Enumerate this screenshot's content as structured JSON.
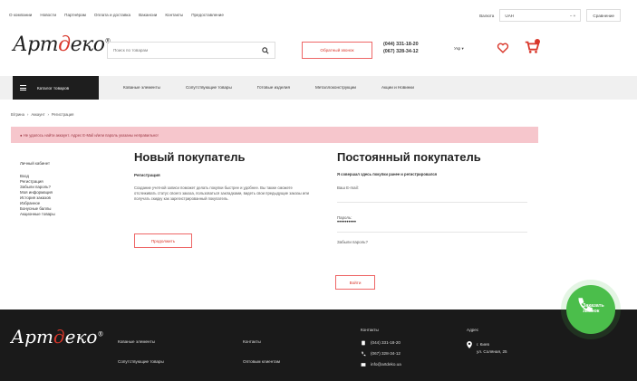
{
  "topbar": {
    "nav": [
      "О компании",
      "Новости",
      "Партнёрам",
      "Оплата и доставка",
      "Вакансии",
      "Контакты",
      "Предоставление"
    ],
    "currency_label": "Валюта",
    "currency_value": "UAH",
    "qty_controls": "−  +",
    "compare_label": "Сравнение"
  },
  "header": {
    "logo_main": "Арт",
    "logo_accent": "д",
    "logo_tail": "еко",
    "logo_mark": "®",
    "search_placeholder": "Поиск по товарам",
    "callback_label": "Обратный звонок",
    "phone1": "(044) 331-18-20",
    "phone2": "(067) 328-34-12",
    "lang": "Укр ▾"
  },
  "navbar": {
    "catalog_label": "Каталог товаров",
    "items": [
      "Кованые элементы",
      "Сопутствующие товары",
      "Готовые изделия",
      "Металлоконструкции",
      "Акции и Новинки"
    ]
  },
  "breadcrumb": [
    "Вітрина",
    "Аккаунт",
    "Регистрация"
  ],
  "alert": {
    "text": "● Не удалось найти аккаунт. Адрес E-Mail и/или пароль указаны неправильно!"
  },
  "sidebar": {
    "title": "Личный кабинет",
    "items": [
      "Вход",
      "Регистрация",
      "Забыли пароль?",
      "Моя информация",
      "История заказов",
      "Избранное",
      "Бонусные баллы",
      "Акционные товары"
    ]
  },
  "new_customer": {
    "title": "Новый покупатель",
    "subtitle": "Регистрация",
    "text": "Создание учетной записи поможет делать покупки быстрее и удобнее. Вы также сможете отслеживать статус своего заказа, пользоваться закладками, видеть свои предыдущие заказы или получать скидку как зарегистрированный покупатель.",
    "button": "Продолжить"
  },
  "returning_customer": {
    "title": "Постоянный покупатель",
    "subtitle": "Я совершал здесь покупки ранее и регистрировался",
    "email_label": "Ваш E-mail:",
    "email_value": "",
    "password_label": "Пароль:",
    "password_value": "••••••••••",
    "forgot_link": "Забыли пароль?",
    "login_button": "Войти"
  },
  "call_fab": {
    "label": "Заказать звонок"
  },
  "footer": {
    "logo_main": "Арт",
    "logo_accent": "д",
    "logo_tail": "еко",
    "logo_mark": "®",
    "col1": [
      "Кованые элементы",
      "Сопутствующие товары"
    ],
    "col2": [
      "Контакты",
      "Оптовым клиентам"
    ],
    "contacts_title": "Контакты",
    "contacts": [
      "(044) 331-18-20",
      "(067) 328-34-12",
      "info@artdeko.ua"
    ],
    "address_title": "Адрес",
    "address_city": "г. Киев",
    "address_street": "ул. Соляная, 25"
  },
  "colors": {
    "accent": "#d9372b",
    "alert_bg": "#f6c6cc",
    "footer_bg": "#1a1a1a",
    "fab": "#4cbf4c"
  }
}
